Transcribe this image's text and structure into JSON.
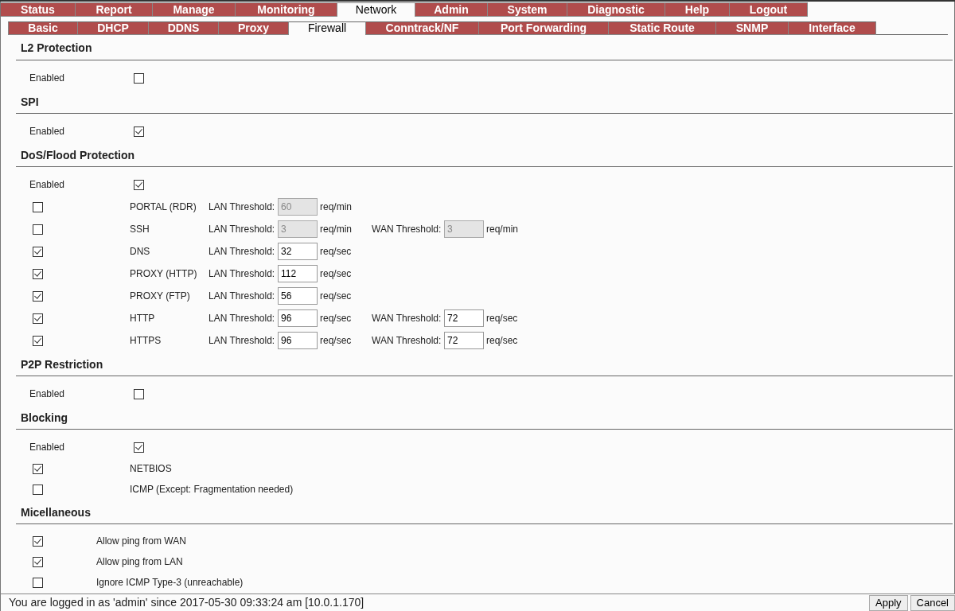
{
  "menu": [
    {
      "label": "Status",
      "selected": false
    },
    {
      "label": "Report",
      "selected": false
    },
    {
      "label": "Manage",
      "selected": false
    },
    {
      "label": "Monitoring",
      "selected": false
    },
    {
      "label": "Network",
      "selected": true
    },
    {
      "label": "Admin",
      "selected": false
    },
    {
      "label": "System",
      "selected": false
    },
    {
      "label": "Diagnostic",
      "selected": false
    },
    {
      "label": "Help",
      "selected": false
    },
    {
      "label": "Logout",
      "selected": false
    }
  ],
  "submenu": [
    {
      "label": "Basic",
      "selected": false
    },
    {
      "label": "DHCP",
      "selected": false
    },
    {
      "label": "DDNS",
      "selected": false
    },
    {
      "label": "Proxy",
      "selected": false
    },
    {
      "label": "Firewall",
      "selected": true
    },
    {
      "label": "Conntrack/NF",
      "selected": false
    },
    {
      "label": "Port Forwarding",
      "selected": false
    },
    {
      "label": "Static Route",
      "selected": false
    },
    {
      "label": "SNMP",
      "selected": false
    },
    {
      "label": "Interface",
      "selected": false
    }
  ],
  "sections": [
    {
      "title": "L2 Protection",
      "rows": [
        {
          "kind": "enabled",
          "label": "Enabled",
          "checked": false
        }
      ]
    },
    {
      "title": "SPI",
      "rows": [
        {
          "kind": "enabled",
          "label": "Enabled",
          "checked": true
        }
      ]
    },
    {
      "title": "DoS/Flood Protection",
      "rows": [
        {
          "kind": "enabled",
          "label": "Enabled",
          "checked": true
        },
        {
          "kind": "threshold",
          "label": "PORTAL (RDR)",
          "checked": false,
          "lan": {
            "label": "LAN Threshold:",
            "value": "60",
            "unit": "req/min",
            "disabled": true
          }
        },
        {
          "kind": "threshold",
          "label": "SSH",
          "checked": false,
          "lan": {
            "label": "LAN Threshold:",
            "value": "3",
            "unit": "req/min",
            "disabled": true
          },
          "wan": {
            "label": "WAN Threshold:",
            "value": "3",
            "unit": "req/min",
            "disabled": true
          }
        },
        {
          "kind": "threshold",
          "label": "DNS",
          "checked": true,
          "lan": {
            "label": "LAN Threshold:",
            "value": "32",
            "unit": "req/sec",
            "disabled": false
          }
        },
        {
          "kind": "threshold",
          "label": "PROXY (HTTP)",
          "checked": true,
          "lan": {
            "label": "LAN Threshold:",
            "value": "112",
            "unit": "req/sec",
            "disabled": false
          }
        },
        {
          "kind": "threshold",
          "label": "PROXY (FTP)",
          "checked": true,
          "lan": {
            "label": "LAN Threshold:",
            "value": "56",
            "unit": "req/sec",
            "disabled": false
          }
        },
        {
          "kind": "threshold",
          "label": "HTTP",
          "checked": true,
          "lan": {
            "label": "LAN Threshold:",
            "value": "96",
            "unit": "req/sec",
            "disabled": false
          },
          "wan": {
            "label": "WAN Threshold:",
            "value": "72",
            "unit": "req/sec",
            "disabled": false
          }
        },
        {
          "kind": "threshold",
          "label": "HTTPS",
          "checked": true,
          "lan": {
            "label": "LAN Threshold:",
            "value": "96",
            "unit": "req/sec",
            "disabled": false
          },
          "wan": {
            "label": "WAN Threshold:",
            "value": "72",
            "unit": "req/sec",
            "disabled": false
          }
        }
      ]
    },
    {
      "title": "P2P Restriction",
      "rows": [
        {
          "kind": "enabled",
          "label": "Enabled",
          "checked": false
        }
      ]
    },
    {
      "title": "Blocking",
      "rows": [
        {
          "kind": "enabled",
          "label": "Enabled",
          "checked": true
        },
        {
          "kind": "item",
          "label": "NETBIOS",
          "checked": true
        },
        {
          "kind": "item",
          "label": "ICMP (Except: Fragmentation needed)",
          "checked": false
        }
      ]
    },
    {
      "title": "Micellaneous",
      "rows": [
        {
          "kind": "misc",
          "label": "Allow ping from WAN",
          "checked": true
        },
        {
          "kind": "misc",
          "label": "Allow ping from LAN",
          "checked": true
        },
        {
          "kind": "misc",
          "label": "Ignore ICMP Type-3 (unreachable)",
          "checked": false
        }
      ]
    }
  ],
  "status_bar": {
    "text": "You are logged in as 'admin' since 2017-05-30 09:33:24 am [10.0.1.170]",
    "buttons": [
      "Apply",
      "Cancel"
    ]
  }
}
